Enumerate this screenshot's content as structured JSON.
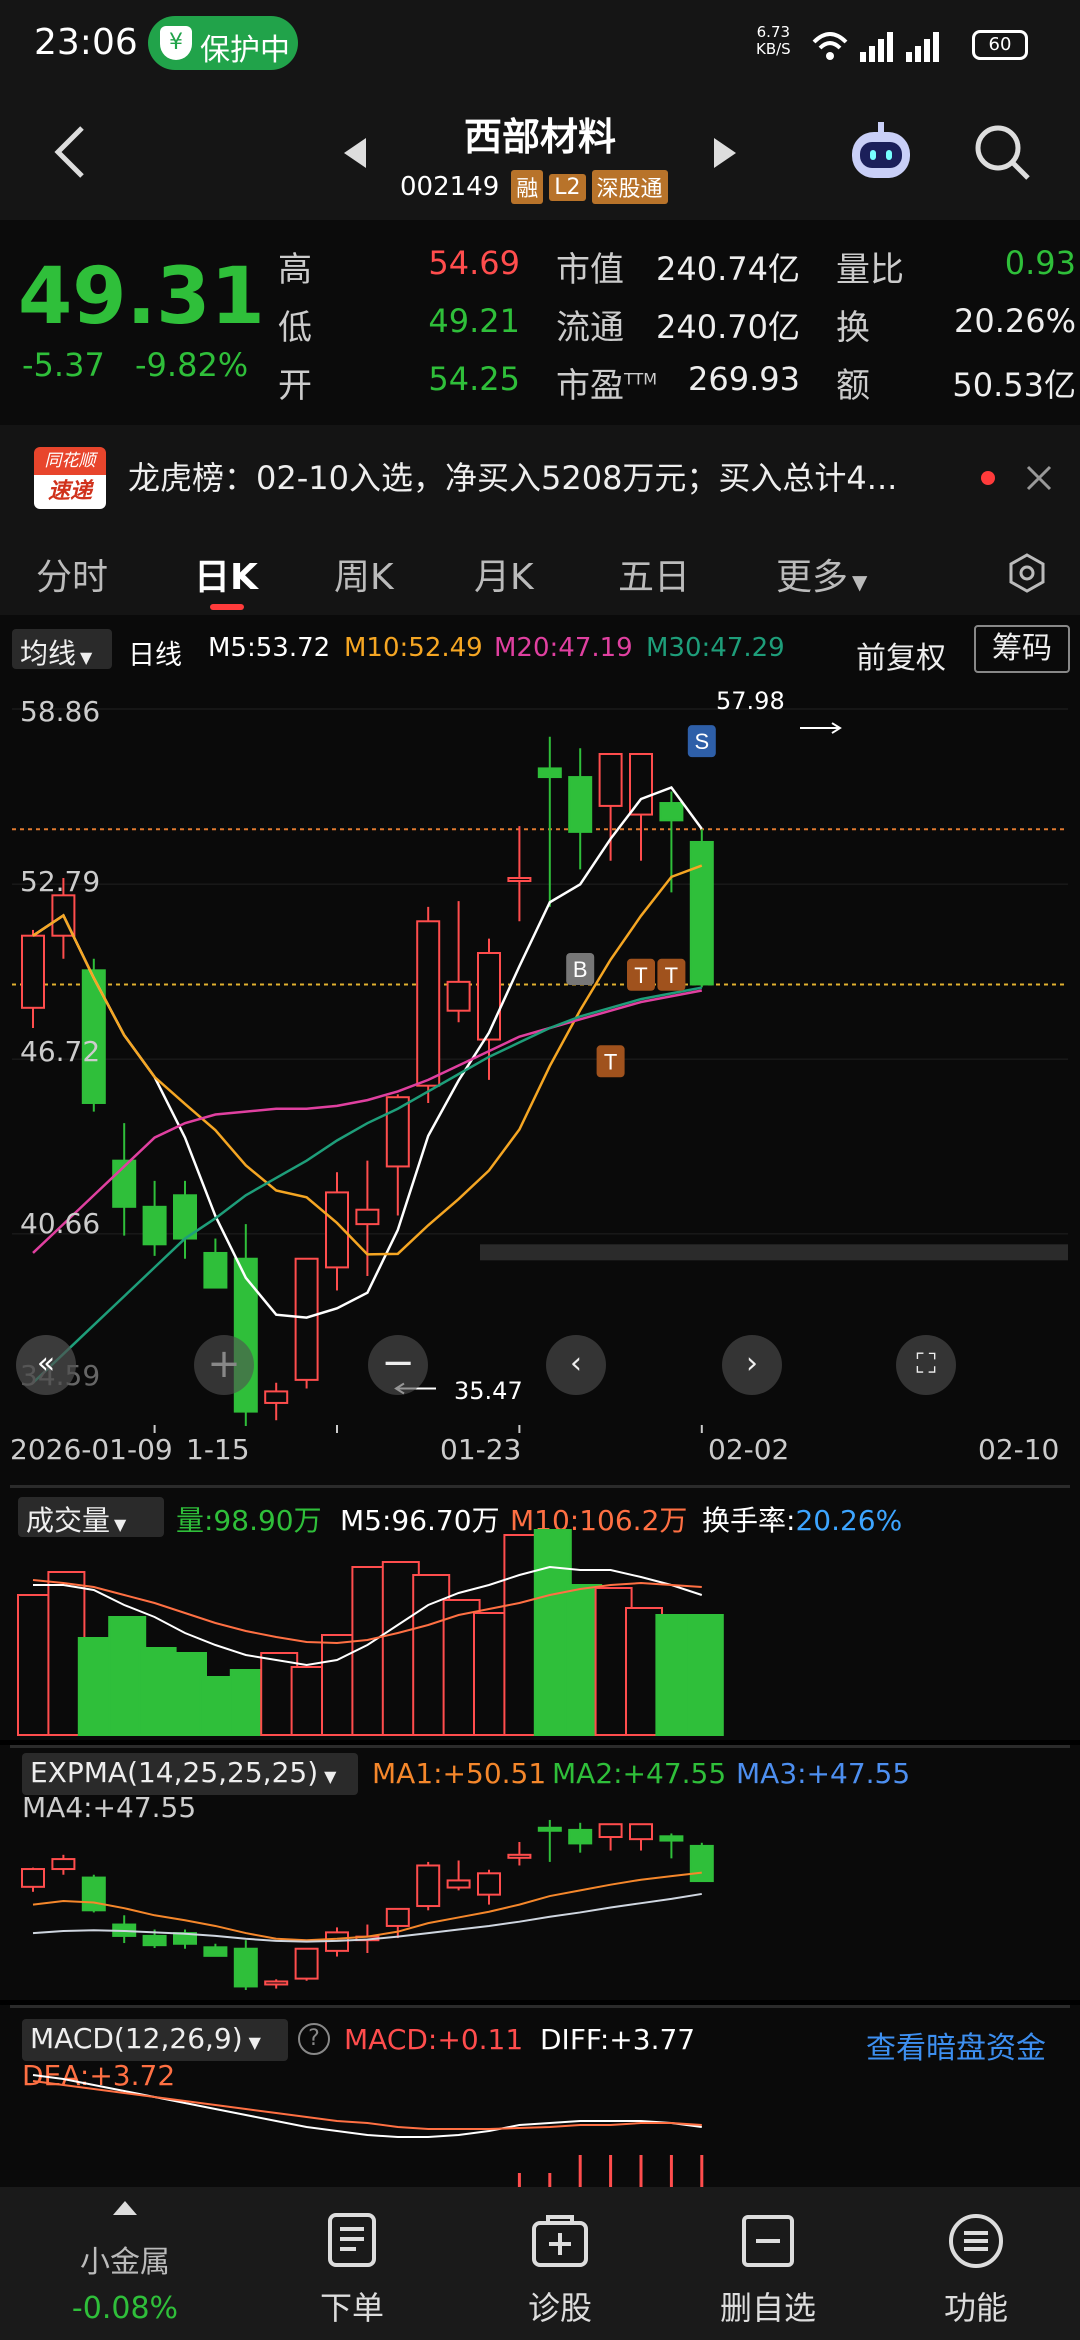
{
  "status_bar": {
    "time": "23:06",
    "protect_badge": "保护中",
    "net_speed_value": "6.73",
    "net_speed_unit": "KB/S",
    "battery": "60"
  },
  "nav": {
    "title": "西部材料",
    "code": "002149",
    "tags": [
      "融",
      "L2",
      "深股通"
    ]
  },
  "quote": {
    "price": "49.31",
    "change": "-5.37",
    "change_pct": "-9.82%",
    "high_label": "高",
    "high": "54.69",
    "low_label": "低",
    "low": "49.21",
    "open_label": "开",
    "open": "54.25",
    "mcap_label": "市值",
    "mcap": "240.74亿",
    "float_label": "流通",
    "float": "240.70亿",
    "pe_label": "市盈",
    "pe_suffix": "TTM",
    "pe": "269.93",
    "vr_label": "量比",
    "vr": "0.93",
    "turn_label": "换",
    "turn": "20.26%",
    "amt_label": "额",
    "amt": "50.53亿"
  },
  "news": {
    "logo_top": "同花顺",
    "logo_bottom": "速递",
    "text": "龙虎榜：02-10入选，净买入5208万元；买入总计4..."
  },
  "tabs": [
    "分时",
    "日K",
    "周K",
    "月K",
    "五日",
    "更多"
  ],
  "active_tab": "日K",
  "kline": {
    "ma_select": "均线",
    "period": "日线",
    "m5": "M5:53.72",
    "m10": "M10:52.49",
    "m20": "M20:47.19",
    "m30": "M30:47.29",
    "adjust": "前复权",
    "chip": "筹码",
    "y_labels": [
      "58.86",
      "52.79",
      "46.72",
      "40.66",
      "34.59"
    ],
    "high_note": "57.98",
    "low_note": "35.47",
    "x_labels": [
      "2026-01-09",
      "1-15",
      "01-23",
      "02-02",
      "02-10"
    ],
    "markers": [
      "B",
      "T",
      "T",
      "T",
      "S"
    ]
  },
  "chart_data": {
    "type": "candlestick",
    "x": [
      "01-09",
      "01-12",
      "01-13",
      "01-14",
      "01-15",
      "01-16",
      "01-19",
      "01-20",
      "01-21",
      "01-22",
      "01-23",
      "01-26",
      "01-27",
      "01-28",
      "01-29",
      "01-30",
      "02-02",
      "02-03",
      "02-04",
      "02-05",
      "02-06",
      "02-09",
      "02-10"
    ],
    "ylim": [
      34.59,
      58.86
    ],
    "candles": [
      [
        48.5,
        51.2,
        47.8,
        51.0
      ],
      [
        51.0,
        53.0,
        50.2,
        52.4
      ],
      [
        49.8,
        50.2,
        44.9,
        45.2
      ],
      [
        43.2,
        44.5,
        40.6,
        41.6
      ],
      [
        41.6,
        42.5,
        39.9,
        40.3
      ],
      [
        42.0,
        42.5,
        39.8,
        40.5
      ],
      [
        40.0,
        40.5,
        38.9,
        38.8
      ],
      [
        39.8,
        41.0,
        34.0,
        34.5
      ],
      [
        34.8,
        35.5,
        34.2,
        35.2
      ],
      [
        35.6,
        39.8,
        35.3,
        39.8
      ],
      [
        39.5,
        42.8,
        38.7,
        42.1
      ],
      [
        41.0,
        43.2,
        39.2,
        41.5
      ],
      [
        43.0,
        45.5,
        41.3,
        45.4
      ],
      [
        45.8,
        52.0,
        45.2,
        51.5
      ],
      [
        48.4,
        52.2,
        48.0,
        49.4
      ],
      [
        47.4,
        50.9,
        46.0,
        50.4
      ],
      [
        53.0,
        54.8,
        51.5,
        53.0
      ],
      [
        56.8,
        57.9,
        52.0,
        56.5
      ],
      [
        56.5,
        57.5,
        53.3,
        54.6
      ],
      [
        55.5,
        57.0,
        53.6,
        57.3
      ],
      [
        55.2,
        57.0,
        53.6,
        57.3
      ],
      [
        55.6,
        56.0,
        52.5,
        55.0
      ],
      [
        54.25,
        54.69,
        49.21,
        49.31
      ]
    ]
  },
  "volume": {
    "label": "成交量",
    "vol": "量:98.90万",
    "m5": "M5:96.70万",
    "m10": "M10:106.2万",
    "turn_label": "换手率:",
    "turn": "20.26%"
  },
  "expma": {
    "label": "EXPMA(14,25,25,25)",
    "ma1": "MA1:+50.51",
    "ma2": "MA2:+47.55",
    "ma3": "MA3:+47.55",
    "ma4": "MA4:+47.55"
  },
  "macd": {
    "label": "MACD(12,26,9)",
    "macd": "MACD:+0.11",
    "diff": "DIFF:+3.77",
    "dea": "DEA:+3.72",
    "link": "查看暗盘资金"
  },
  "bottom": {
    "index_name": "小金属",
    "index_pct": "-0.08%",
    "items": [
      "下单",
      "诊股",
      "删自选",
      "功能"
    ]
  },
  "colors": {
    "up": "#ff4d4d",
    "down": "#2fbf3a",
    "ma5": "#ffffff",
    "ma10": "#f5a623",
    "ma20": "#e040a0",
    "ma30": "#1e9e7a"
  }
}
